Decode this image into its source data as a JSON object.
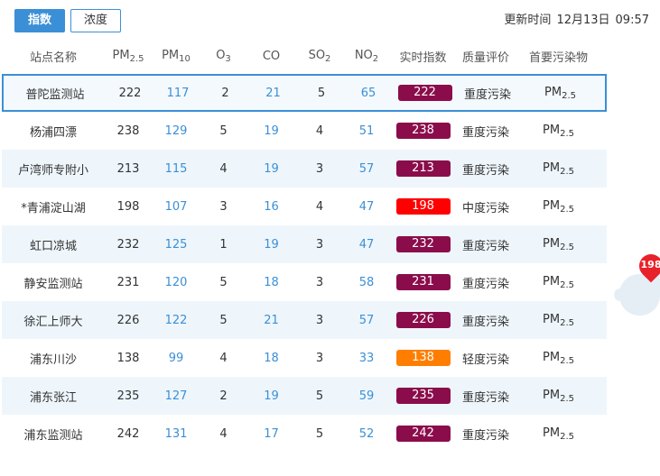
{
  "tabs": [
    {
      "label": "指数",
      "active": true
    },
    {
      "label": "浓度",
      "active": false
    }
  ],
  "update": {
    "label": "更新时间",
    "date": "12月13日",
    "time": "09:57"
  },
  "headers": {
    "name": "站点名称",
    "pm25": {
      "base": "PM",
      "sub": "2.5"
    },
    "pm10": {
      "base": "PM",
      "sub": "10"
    },
    "o3": {
      "base": "O",
      "sub": "3"
    },
    "co": "CO",
    "so2": {
      "base": "SO",
      "sub": "2"
    },
    "no2": {
      "base": "NO",
      "sub": "2"
    },
    "aqi": "实时指数",
    "quality": "质量评价",
    "primary": "首要污染物"
  },
  "colors": {
    "heavy": "#8b0c4b",
    "moderate": "#ff0000",
    "light": "#ff7e00",
    "accent": "#3b8fd6"
  },
  "stations": [
    {
      "name": "普陀监测站",
      "pm25": "222",
      "pm10": "117",
      "o3": "2",
      "co": "21",
      "so2": "5",
      "no2": "65",
      "aqi": "222",
      "quality": "重度污染",
      "level": "heavy",
      "primary_base": "PM",
      "primary_sub": "2.5"
    },
    {
      "name": "杨浦四漂",
      "pm25": "238",
      "pm10": "129",
      "o3": "5",
      "co": "19",
      "so2": "4",
      "no2": "51",
      "aqi": "238",
      "quality": "重度污染",
      "level": "heavy",
      "primary_base": "PM",
      "primary_sub": "2.5"
    },
    {
      "name": "卢湾师专附小",
      "pm25": "213",
      "pm10": "115",
      "o3": "4",
      "co": "19",
      "so2": "3",
      "no2": "57",
      "aqi": "213",
      "quality": "重度污染",
      "level": "heavy",
      "primary_base": "PM",
      "primary_sub": "2.5"
    },
    {
      "name": "*青浦淀山湖",
      "pm25": "198",
      "pm10": "107",
      "o3": "3",
      "co": "16",
      "so2": "4",
      "no2": "47",
      "aqi": "198",
      "quality": "中度污染",
      "level": "moderate",
      "primary_base": "PM",
      "primary_sub": "2.5"
    },
    {
      "name": "虹口凉城",
      "pm25": "232",
      "pm10": "125",
      "o3": "1",
      "co": "19",
      "so2": "3",
      "no2": "47",
      "aqi": "232",
      "quality": "重度污染",
      "level": "heavy",
      "primary_base": "PM",
      "primary_sub": "2.5"
    },
    {
      "name": "静安监测站",
      "pm25": "231",
      "pm10": "120",
      "o3": "5",
      "co": "18",
      "so2": "3",
      "no2": "58",
      "aqi": "231",
      "quality": "重度污染",
      "level": "heavy",
      "primary_base": "PM",
      "primary_sub": "2.5"
    },
    {
      "name": "徐汇上师大",
      "pm25": "226",
      "pm10": "122",
      "o3": "5",
      "co": "21",
      "so2": "3",
      "no2": "57",
      "aqi": "226",
      "quality": "重度污染",
      "level": "heavy",
      "primary_base": "PM",
      "primary_sub": "2.5"
    },
    {
      "name": "浦东川沙",
      "pm25": "138",
      "pm10": "99",
      "o3": "4",
      "co": "18",
      "so2": "3",
      "no2": "33",
      "aqi": "138",
      "quality": "轻度污染",
      "level": "light",
      "primary_base": "PM",
      "primary_sub": "2.5"
    },
    {
      "name": "浦东张江",
      "pm25": "235",
      "pm10": "127",
      "o3": "2",
      "co": "19",
      "so2": "5",
      "no2": "59",
      "aqi": "235",
      "quality": "重度污染",
      "level": "heavy",
      "primary_base": "PM",
      "primary_sub": "2.5"
    },
    {
      "name": "浦东监测站",
      "pm25": "242",
      "pm10": "131",
      "o3": "4",
      "co": "17",
      "so2": "5",
      "no2": "52",
      "aqi": "242",
      "quality": "重度污染",
      "level": "heavy",
      "primary_base": "PM",
      "primary_sub": "2.5"
    }
  ],
  "map_marker": {
    "value": "198"
  }
}
